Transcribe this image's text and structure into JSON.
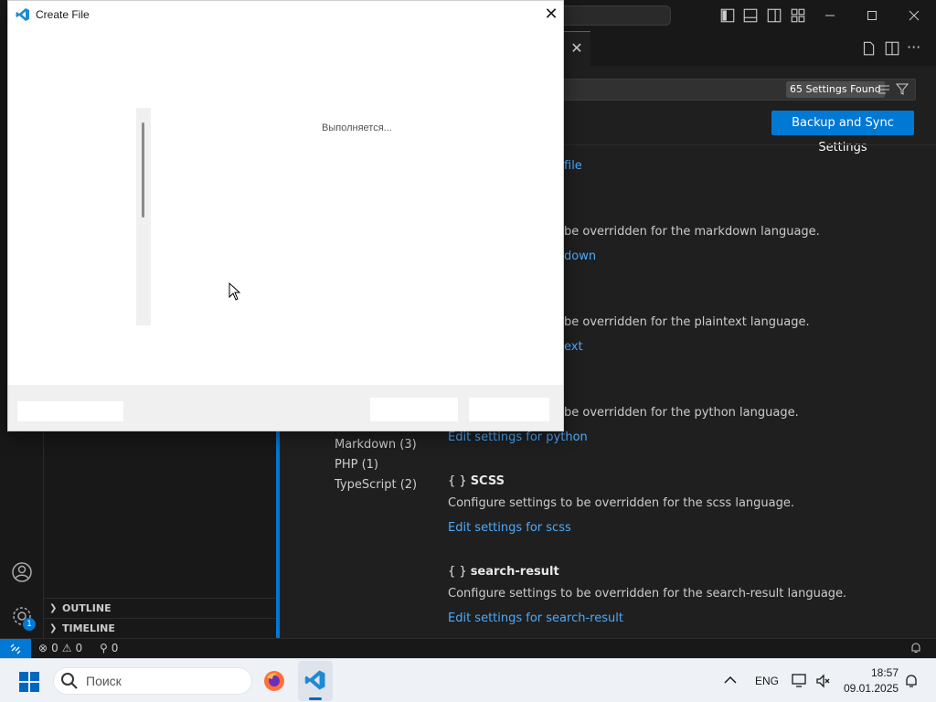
{
  "dialog": {
    "title": "Create File",
    "progress_text": "Выполняется...",
    "close_glyph": "✕"
  },
  "editor": {
    "settings_found": "65 Settings Found",
    "sync_button": "Backup and Sync Settings",
    "toc": [
      "Markdown (3)",
      "PHP (1)",
      "TypeScript (2)"
    ],
    "partial_rows": [
      {
        "link_tail": "file"
      },
      {
        "desc_tail": "be overridden for the markdown language.",
        "link_tail": "down"
      },
      {
        "desc_tail": "be overridden for the plaintext language.",
        "link_tail": "ext"
      },
      {
        "desc_tail": "be overridden for the python language.",
        "link": "Edit settings for python"
      }
    ],
    "settings": [
      {
        "title": "SCSS",
        "desc": "Configure settings to be overridden for the scss language.",
        "link": "Edit settings for scss"
      },
      {
        "title": "search-result",
        "desc": "Configure settings to be overridden for the search-result language.",
        "link": "Edit settings for search-result"
      }
    ],
    "braces": "{ }"
  },
  "sidebar": {
    "outline": "OUTLINE",
    "timeline": "TIMELINE"
  },
  "statusbar": {
    "errors": "0",
    "warnings": "0",
    "ports": "0",
    "accounts_badge": "1"
  },
  "taskbar": {
    "search_placeholder": "Поиск",
    "language": "ENG",
    "time": "18:57",
    "date": "09.01.2025"
  },
  "colors": {
    "accent": "#0078d4",
    "link": "#4daafc",
    "editor_bg": "#1f1f1f"
  }
}
